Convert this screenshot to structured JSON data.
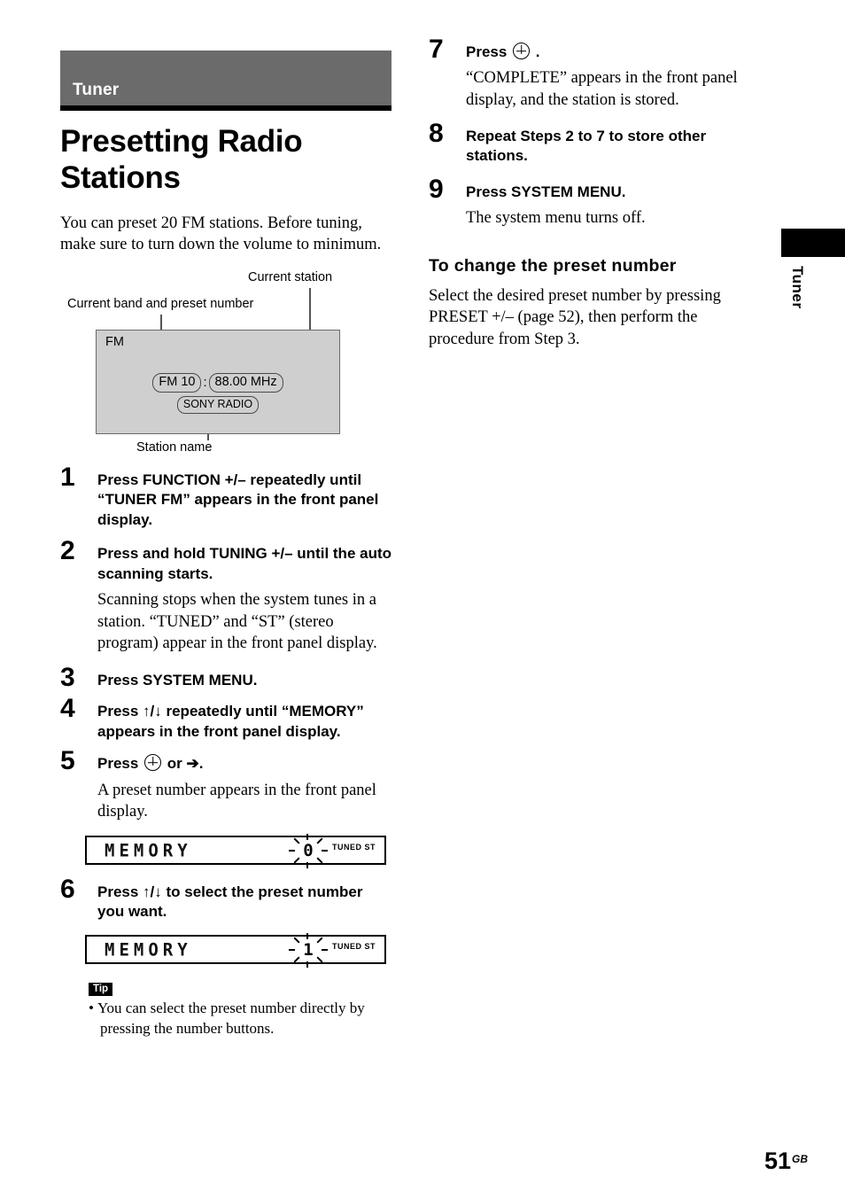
{
  "chapter": {
    "label": "Tuner"
  },
  "title": "Presetting Radio Stations",
  "intro": "You can preset 20 FM stations. Before tuning, make sure to turn down the volume to minimum.",
  "figure": {
    "callout_current_station": "Current station",
    "callout_band_preset": "Current band and preset number",
    "callout_station_name": "Station name",
    "display": {
      "band": "FM",
      "preset": "FM 10",
      "separator": ":",
      "frequency": "88.00 MHz",
      "station_name": "SONY RADIO"
    }
  },
  "steps": [
    {
      "num": "1",
      "head": "Press FUNCTION +/– repeatedly until “TUNER FM” appears in the front panel display.",
      "body": ""
    },
    {
      "num": "2",
      "head": "Press and hold TUNING +/– until the auto scanning starts.",
      "body": "Scanning stops when the system tunes in a station. “TUNED” and “ST” (stereo program) appear in the front panel display."
    },
    {
      "num": "3",
      "head": "Press SYSTEM MENU.",
      "body": ""
    },
    {
      "num": "4",
      "head": "Press ↑/↓ repeatedly until “MEMORY” appears in the front panel display.",
      "body": ""
    },
    {
      "num": "5",
      "head_pre": "Press",
      "head_post": "or ➔.",
      "body": "A preset number appears in the front panel display."
    },
    {
      "num": "6",
      "head": "Press ↑/↓ to select the preset number you want.",
      "body": ""
    },
    {
      "num": "7",
      "head_pre": "Press",
      "head_post": ".",
      "body": "“COMPLETE” appears in the front panel display, and the station is stored."
    },
    {
      "num": "8",
      "head": "Repeat Steps 2 to 7 to store other stations.",
      "body": ""
    },
    {
      "num": "9",
      "head": "Press SYSTEM MENU.",
      "body": "The system menu turns off."
    }
  ],
  "lcd_step5": {
    "text": "MEMORY",
    "digit": "0",
    "indicators": "TUNED ST"
  },
  "lcd_step6": {
    "text": "MEMORY",
    "digit": "1",
    "indicators": "TUNED ST"
  },
  "tip": {
    "badge": "Tip",
    "bullet": "•",
    "line1": "You can select the preset number directly by",
    "line2": "pressing the number buttons."
  },
  "subsection": {
    "heading": "To change the preset number",
    "body": "Select the desired preset number by pressing PRESET +/– (page 52), then perform the procedure from Step 3."
  },
  "side_tab": {
    "label": "Tuner"
  },
  "page": {
    "number": "51",
    "suffix": "GB"
  },
  "colors": {
    "banner_gray": "#6b6b6b",
    "display_gray": "#cfcfcf",
    "rule_black": "#000000"
  }
}
